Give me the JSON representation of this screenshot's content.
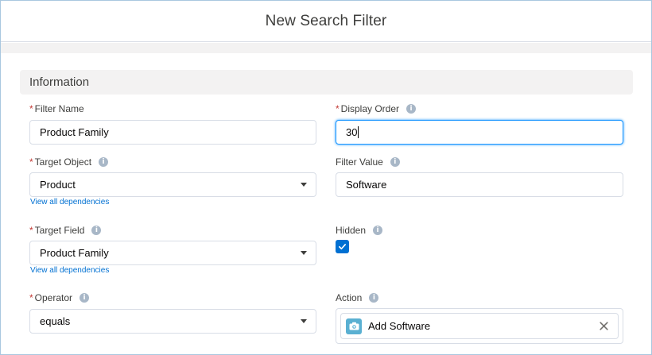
{
  "modal": {
    "title": "New Search Filter"
  },
  "section": {
    "title": "Information"
  },
  "fields": {
    "filter_name": {
      "label": "Filter Name",
      "value": "Product Family"
    },
    "display_order": {
      "label": "Display Order",
      "value": "30"
    },
    "target_object": {
      "label": "Target Object",
      "value": "Product",
      "link": "View all dependencies"
    },
    "filter_value": {
      "label": "Filter Value",
      "value": "Software"
    },
    "target_field": {
      "label": "Target Field",
      "value": "Product Family",
      "link": "View all dependencies"
    },
    "hidden": {
      "label": "Hidden",
      "checked": true
    },
    "operator": {
      "label": "Operator",
      "value": "equals"
    },
    "action": {
      "label": "Action",
      "value": "Add Software"
    }
  },
  "required_marker": "*",
  "info_glyph": "i",
  "colors": {
    "accent": "#0070d2",
    "required": "#c23934",
    "focus": "#1b96ff",
    "action_icon_bg": "#5ab0d2"
  }
}
